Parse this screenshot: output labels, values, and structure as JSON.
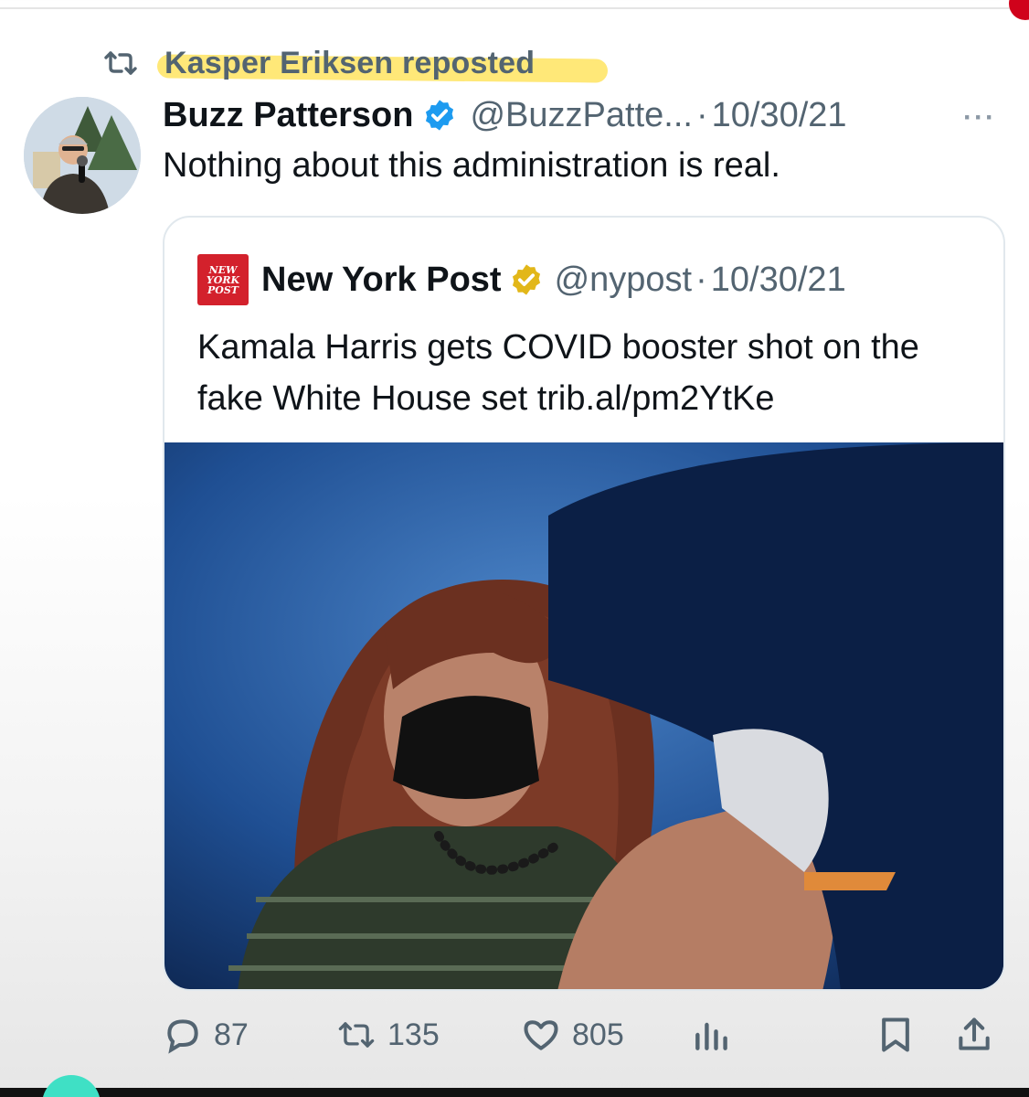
{
  "repost": {
    "label": "Kasper Eriksen reposted",
    "icon": "repost-icon"
  },
  "tweet": {
    "author_name": "Buzz Patterson",
    "handle": "@BuzzPatte...",
    "separator": "·",
    "date": "10/30/21",
    "text": "Nothing about this administration is real.",
    "more": "···",
    "verified_color": "#1d9bf0"
  },
  "quote": {
    "logo_lines": [
      "NEW",
      "YORK",
      "POST"
    ],
    "name": "New York Post",
    "handle": "@nypost",
    "separator": "·",
    "date": "10/30/21",
    "text": "Kamala Harris gets COVID booster shot on the fake White House set trib.al/pm2YtKe",
    "verified_color": "#e2b719"
  },
  "actions": {
    "replies": "87",
    "reposts": "135",
    "likes": "805"
  },
  "colors": {
    "highlight": "#ffd60a",
    "secondary_text": "#536471",
    "nypost_red": "#d3212c"
  }
}
